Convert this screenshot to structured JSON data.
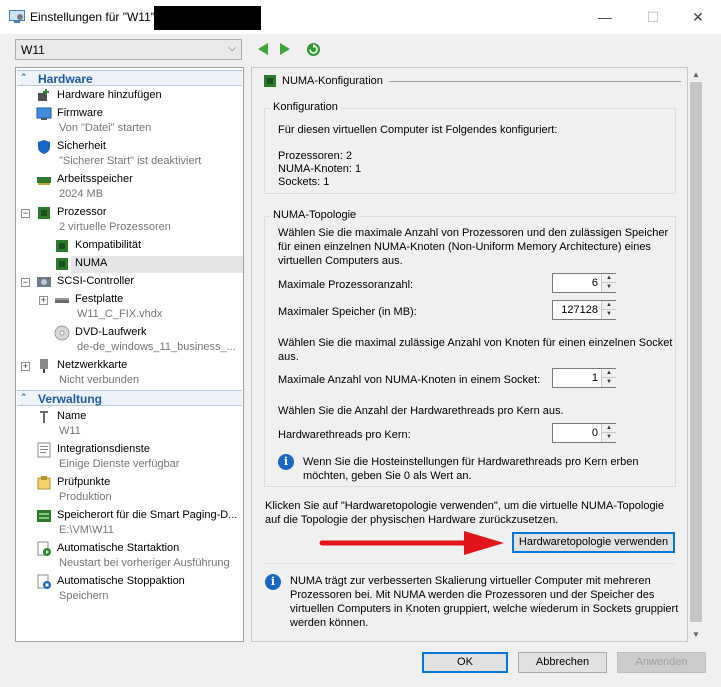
{
  "window": {
    "title": "Einstellungen für \"W11\"",
    "controls": [
      "minimize",
      "maximize",
      "close"
    ]
  },
  "vm_selector": {
    "value": "W11"
  },
  "left_panel": {
    "sections": [
      {
        "label": "Hardware"
      },
      {
        "label": "Verwaltung"
      }
    ],
    "hardware_items": [
      {
        "name": "Hardware hinzufügen",
        "sub": ""
      },
      {
        "name": "Firmware",
        "sub": "Von \"Datei\" starten"
      },
      {
        "name": "Sicherheit",
        "sub": "\"Sicherer Start\" ist deaktiviert"
      },
      {
        "name": "Arbeitsspeicher",
        "sub": "2024 MB"
      },
      {
        "name": "Prozessor",
        "sub": "2 virtuelle Prozessoren"
      },
      {
        "name": "Kompatibilität",
        "sub": ""
      },
      {
        "name": "NUMA",
        "sub": ""
      },
      {
        "name": "SCSI-Controller",
        "sub": ""
      },
      {
        "name": "Festplatte",
        "sub": "W11_C_FIX.vhdx"
      },
      {
        "name": "DVD-Laufwerk",
        "sub": "de-de_windows_11_business_..."
      },
      {
        "name": "Netzwerkkarte",
        "sub": "Nicht verbunden"
      }
    ],
    "management_items": [
      {
        "name": "Name",
        "sub": "W11"
      },
      {
        "name": "Integrationsdienste",
        "sub": "Einige Dienste verfügbar"
      },
      {
        "name": "Prüfpunkte",
        "sub": "Produktion"
      },
      {
        "name": "Speicherort für die Smart Paging-D...",
        "sub": "E:\\VM\\W11"
      },
      {
        "name": "Automatische Startaktion",
        "sub": "Neustart bei vorheriger Ausführung"
      },
      {
        "name": "Automatische Stoppaktion",
        "sub": "Speichern"
      }
    ]
  },
  "right_panel": {
    "header": "NUMA-Konfiguration",
    "config_group": {
      "title": "Konfiguration",
      "intro": "Für diesen virtuellen Computer ist Folgendes konfiguriert:",
      "processors": "Prozessoren: 2",
      "numa_nodes": "NUMA-Knoten: 1",
      "sockets": "Sockets: 1"
    },
    "topology_group": {
      "title": "NUMA-Topologie",
      "description_1": "Wählen Sie die maximale Anzahl von Prozessoren und den zulässigen Speicher",
      "description_2": "für einen einzelnen NUMA-Knoten (Non-Uniform Memory Architecture) eines",
      "description_3": "virtuellen Computers aus.",
      "max_processors_label": "Maximale Prozessoranzahl:",
      "max_processors_value": "6",
      "max_memory_label": "Maximaler Speicher (in MB):",
      "max_memory_value": "127128",
      "nodes_desc_1": "Wählen Sie die maximal zulässige Anzahl von Knoten für einen einzelnen Socket",
      "nodes_desc_2": "aus.",
      "max_nodes_label": "Maximale Anzahl von NUMA-Knoten in einem Socket:",
      "max_nodes_value": "1",
      "threads_desc": "Wählen Sie die Anzahl der Hardwarethreads pro Kern aus.",
      "threads_label": "Hardwarethreads pro Kern:",
      "threads_value": "0",
      "info_1": "Wenn Sie die Hosteinstellungen für Hardwarethreads pro Kern erben",
      "info_2": "möchten, geben Sie 0 als Wert an."
    },
    "reset_text_1": "Klicken Sie auf \"Hardwaretopologie verwenden\", um die virtuelle NUMA-Topologie",
    "reset_text_2": "auf die Topologie der physischen Hardware zurückzusetzen.",
    "use_topology_button": "Hardwaretopologie verwenden",
    "footer_info_1": "NUMA trägt zur verbesserten Skalierung virtueller Computer mit mehreren",
    "footer_info_2": "Prozessoren bei. Mit NUMA werden die Prozessoren und der Speicher des",
    "footer_info_3": "virtuellen Computers in Knoten gruppiert, welche wiederum in Sockets gruppiert",
    "footer_info_4": "werden können."
  },
  "buttons": {
    "ok": "OK",
    "cancel": "Abbrechen",
    "apply": "Anwenden"
  },
  "colors": {
    "accent": "#1e5aa6",
    "arrow": "#e0161b",
    "nav_green": "#3aa53a"
  }
}
